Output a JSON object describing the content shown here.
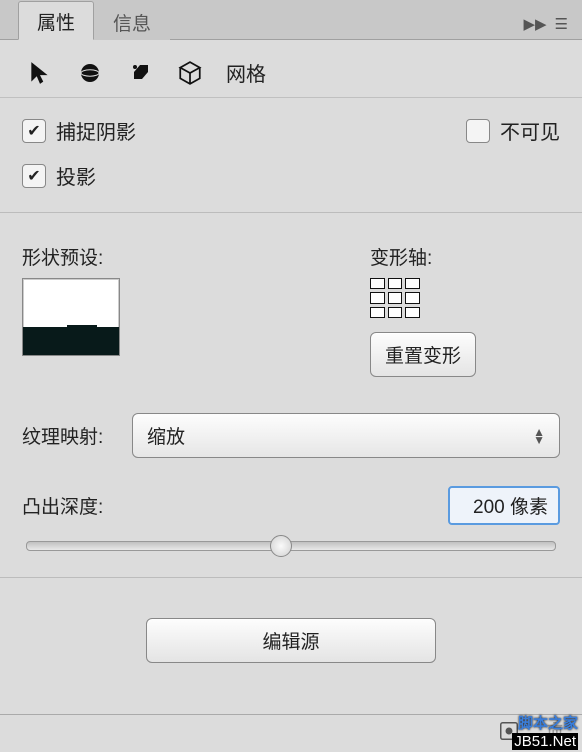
{
  "tabs": {
    "properties": "属性",
    "info": "信息"
  },
  "toolbar": {
    "mesh_label": "网格",
    "icons": {
      "cursor": "cursor-icon",
      "sphere": "sphere-icon",
      "extrude": "extrude-icon",
      "cube": "cube-icon"
    }
  },
  "checkboxes": {
    "capture_shadow": "捕捉阴影",
    "projection": "投影",
    "invisible": "不可见"
  },
  "labels": {
    "shape_preset": "形状预设:",
    "deform_axis": "变形轴:",
    "reset_deform": "重置变形",
    "texture_map": "纹理映射:",
    "extrude_depth": "凸出深度:",
    "edit_source": "编辑源"
  },
  "texture_map": {
    "selected": "缩放"
  },
  "depth": {
    "value": "200 像素",
    "slider_percent": 48
  },
  "watermark": {
    "line1": "脚本之家",
    "line2": "JB51.Net"
  }
}
